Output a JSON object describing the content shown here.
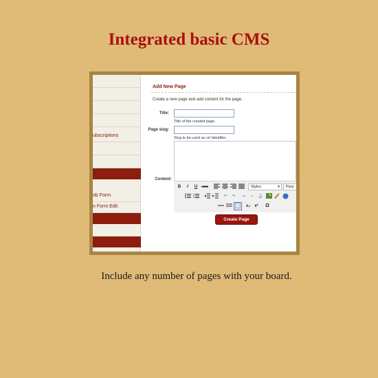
{
  "headline": "Integrated basic CMS",
  "caption": "Include any number of pages with your board.",
  "screenshot": {
    "sidebar": {
      "items": [
        {
          "label": ""
        },
        {
          "label": ""
        },
        {
          "label": ""
        },
        {
          "label": ""
        },
        {
          "label": "ubscriptions"
        },
        {
          "label": ""
        },
        {
          "label": ""
        },
        {
          "label": ""
        },
        {
          "label": "ob Form"
        },
        {
          "label": "n Form Edit"
        }
      ]
    },
    "form": {
      "title": "Add New Page",
      "intro": "Create a new page and add content for the page.",
      "title_label": "Title:",
      "title_value": "",
      "title_hint": "Title of the created page.",
      "slug_label": "Page slug:",
      "slug_value": "",
      "slug_hint": "Slug to be used as url identifier.",
      "content_label": "Content:",
      "styles_select": "Styles",
      "format_select": "Para",
      "submit_label": "Create Page"
    },
    "toolbar_icons": {
      "bold": "B",
      "italic": "I",
      "underline": "U",
      "strike": "ABC",
      "omega": "Ω",
      "sub": "x₂",
      "sup": "x²"
    },
    "colors": {
      "page_bg": "#dfbb77",
      "headline": "#a8100c",
      "accent_red": "#8c1d0f",
      "frame": "#a88443"
    }
  }
}
